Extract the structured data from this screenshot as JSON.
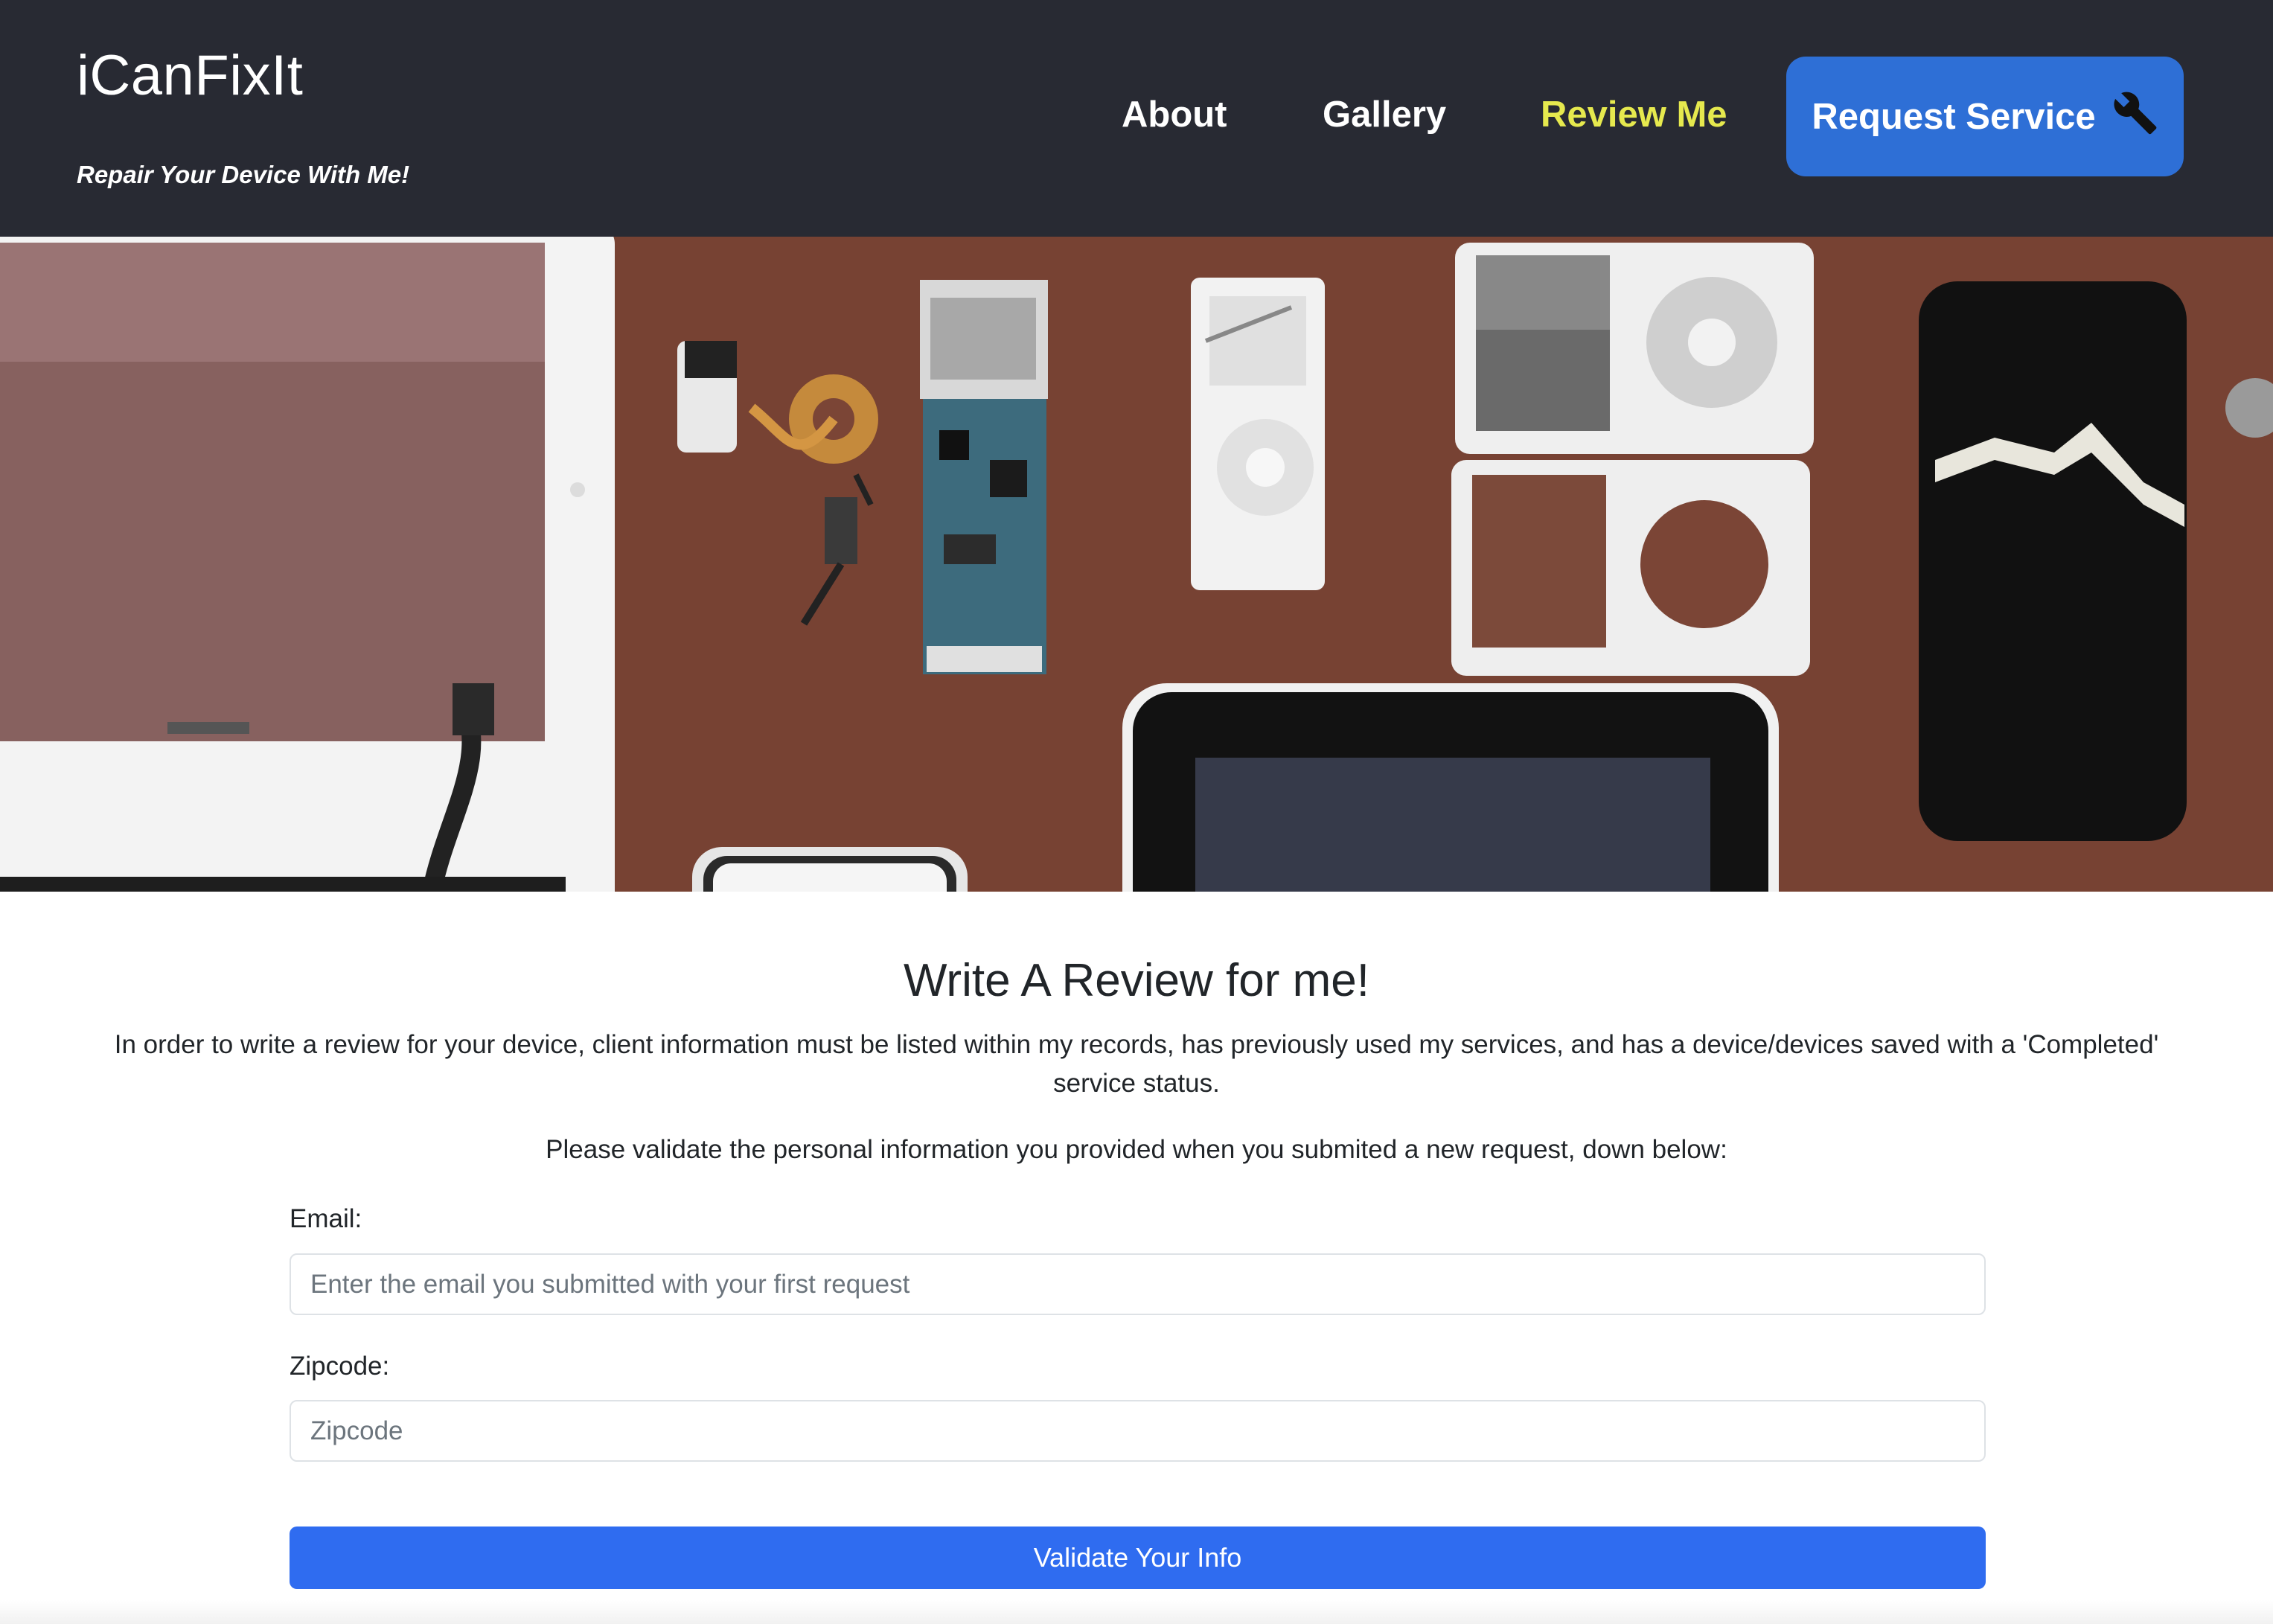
{
  "header": {
    "brand": "iCanFixIt",
    "tagline": "Repair Your Device With Me!",
    "nav": {
      "about": "About",
      "gallery": "Gallery",
      "review": "Review Me"
    },
    "request_button": "Request Service",
    "request_icon": "wrench-icon",
    "active_nav_color": "#e6e94e",
    "background_color": "#282a33",
    "button_color": "#2e6fd6"
  },
  "hero": {
    "image": "repair-parts-photo"
  },
  "review": {
    "title": "Write A Review for me!",
    "intro": "In order to write a review for your device, client information must be listed within my records, has previously used my services, and has a device/devices saved with a 'Completed' service status.",
    "instruction": "Please validate the personal information you provided when you submited a new request, down below:",
    "email": {
      "label": "Email:",
      "placeholder": "Enter the email you submitted with your first request",
      "value": ""
    },
    "zipcode": {
      "label": "Zipcode:",
      "placeholder": "Zipcode",
      "value": ""
    },
    "submit_label": "Validate Your Info",
    "submit_color": "#2f6cf0"
  }
}
